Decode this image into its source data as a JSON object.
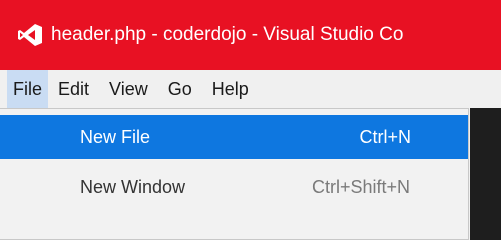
{
  "window": {
    "title": "header.php - coderdojo - Visual Studio Co",
    "icon": "visual-studio-code-icon",
    "accent_color": "#e81123"
  },
  "menubar": {
    "items": [
      {
        "label": "File"
      },
      {
        "label": "Edit"
      },
      {
        "label": "View"
      },
      {
        "label": "Go"
      },
      {
        "label": "Help"
      }
    ]
  },
  "file_menu": {
    "items": [
      {
        "label": "New File",
        "shortcut": "Ctrl+N"
      },
      {
        "label": "New Window",
        "shortcut": "Ctrl+Shift+N"
      }
    ],
    "highlight_color": "#0e77e0"
  }
}
